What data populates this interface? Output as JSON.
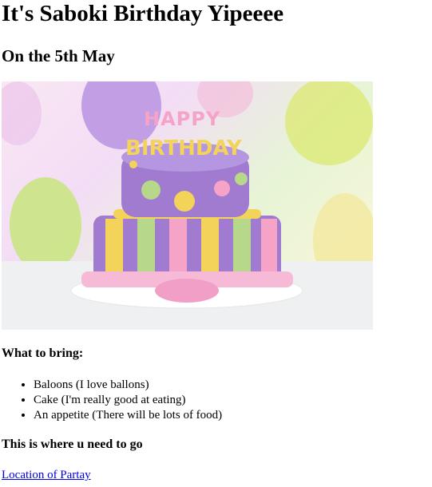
{
  "header": {
    "title": "It's Saboki Birthday Yipeeee",
    "subtitle": "On the 5th May"
  },
  "hero": {
    "alt": "Birthday cake with HAPPY BIRTHDAY candles",
    "candles_happy": "HAPPY",
    "candles_birthday": "BIRTHDAY"
  },
  "bring": {
    "heading": "What to bring:",
    "items": [
      "Baloons (I love ballons)",
      "Cake (I'm really good at eating)",
      "An appetite (There will be lots of food)"
    ]
  },
  "location": {
    "heading": "This is where u need to go",
    "link_text": "Location of Partay"
  },
  "colors": {
    "link": "#0000ee",
    "cake_purple": "#a07bd0",
    "cake_pink": "#f6a3c8",
    "cake_yellow": "#f3d35a",
    "cake_green": "#b7d88a"
  }
}
